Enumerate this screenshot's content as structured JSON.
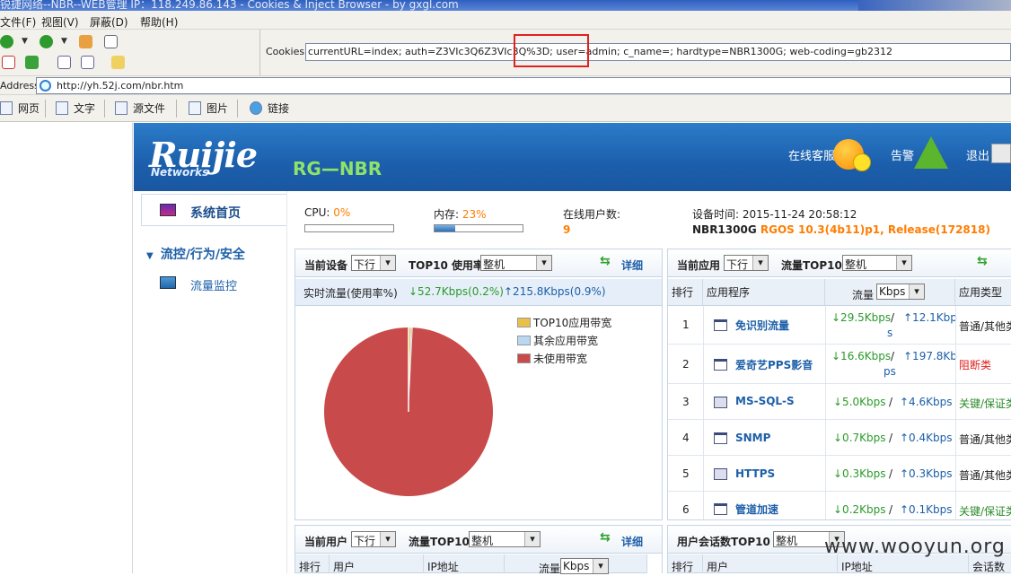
{
  "window": {
    "title": "锐捷网络--NBR--WEB管理 IP：118.249.86.143 - Cookies & Inject Browser - by gxgl.com"
  },
  "menu": [
    "文件(F)",
    "视图(V)",
    "屏蔽(D)",
    "帮助(H)"
  ],
  "cookies": {
    "label": "Cookies:",
    "value": "currentURL=index; auth=Z3VIc3Q6Z3VIc3Q%3D; user=admin; c_name=; hardtype=NBR1300G; web-coding=gb2312"
  },
  "address": {
    "label": "Address:",
    "url": "http://yh.52j.com/nbr.htm"
  },
  "links": [
    "网页",
    "文字",
    "源文件",
    "图片",
    "链接"
  ],
  "banner": {
    "logo": "Ruijie",
    "logo_sub": "Networks",
    "product": "RG—NBR",
    "service": "在线客服",
    "alarm": "告警",
    "logout": "退出"
  },
  "sidebar": {
    "home": "系统首页",
    "section": "流控/行为/安全",
    "monitor": "流量监控"
  },
  "status": {
    "cpu_label": "CPU:",
    "cpu_value": "0%",
    "cpu_fraction": 0.0,
    "mem_label": "内存:",
    "mem_value": "23%",
    "mem_fraction": 0.23,
    "users_label": "在线用户数:",
    "users_value": "9",
    "time_label": "设备时间:",
    "time_value": "2015-11-24 20:58:12",
    "model": "NBR1300G",
    "version": "RGOS 10.3(4b11)p1, Release(172818)"
  },
  "device_panel": {
    "label": "当前设备",
    "dir": "下行",
    "top_label": "TOP10 使用率",
    "scope": "整机",
    "detail": "详细",
    "realtime_label": "实时流量(使用率%)",
    "down": "↓52.7Kbps(0.2%)",
    "up": "↑215.8Kbps(0.9%)",
    "legend": [
      "TOP10应用带宽",
      "其余应用带宽",
      "未使用带宽"
    ],
    "colors": {
      "top10": "#e8c04a",
      "others": "#b9d7f1",
      "unused": "#c94a4a"
    }
  },
  "chart_data": {
    "type": "pie",
    "labels": [
      "TOP10应用带宽",
      "其余应用带宽",
      "未使用带宽"
    ],
    "values": [
      0.5,
      0.3,
      99.2
    ]
  },
  "app_panel": {
    "label": "当前应用",
    "dir": "下行",
    "top_label": "流量TOP10",
    "scope": "整机",
    "headers": [
      "排行",
      "应用程序",
      "流量",
      "Kbps",
      "应用类型"
    ],
    "rows": [
      {
        "rank": "1",
        "name": "免识别流量",
        "down": "↓29.5Kbps",
        "sep": "/",
        "up": "↑12.1Kbp",
        "up2": "s",
        "type": "普通/其他类"
      },
      {
        "rank": "2",
        "name": "爱奇艺PPS影音",
        "down": "↓16.6Kbps",
        "sep": "/",
        "up": "↑197.8Kb",
        "up2": "ps",
        "type": "阻断类"
      },
      {
        "rank": "3",
        "name": "MS-SQL-S",
        "down": "↓5.0Kbps",
        "sep": "/",
        "up": "↑4.6Kbps",
        "up2": "",
        "type": "关键/保证类"
      },
      {
        "rank": "4",
        "name": "SNMP",
        "down": "↓0.7Kbps",
        "sep": "/",
        "up": "↑0.4Kbps",
        "up2": "",
        "type": "普通/其他类"
      },
      {
        "rank": "5",
        "name": "HTTPS",
        "down": "↓0.3Kbps",
        "sep": "/",
        "up": "↑0.3Kbps",
        "up2": "",
        "type": "普通/其他类"
      },
      {
        "rank": "6",
        "name": "管道加速",
        "down": "↓0.2Kbps",
        "sep": "/",
        "up": "↑0.1Kbps",
        "up2": "",
        "type": "关键/保证类"
      }
    ]
  },
  "user_panel": {
    "label": "当前用户",
    "dir": "下行",
    "top_label": "流量TOP10",
    "scope": "整机",
    "detail": "详细",
    "headers": [
      "排行",
      "用户",
      "IP地址",
      "流量",
      "Kbps"
    ]
  },
  "session_panel": {
    "label": "用户会话数TOP10",
    "scope": "整机",
    "headers": [
      "排行",
      "用户",
      "IP地址",
      "会话数"
    ]
  },
  "watermark": "www.wooyun.org"
}
